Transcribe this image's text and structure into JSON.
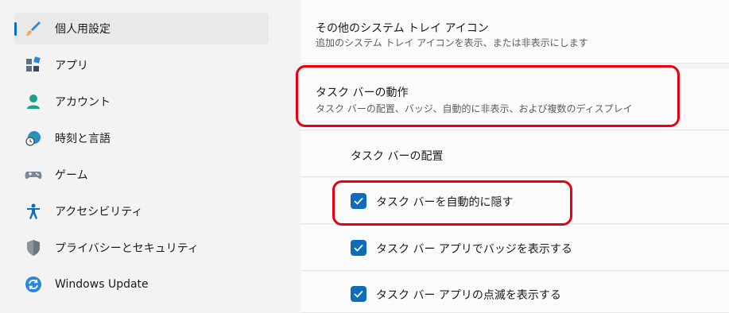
{
  "sidebar": {
    "items": [
      {
        "label": "個人用設定",
        "icon": "paintbrush-icon",
        "active": true
      },
      {
        "label": "アプリ",
        "icon": "apps-icon"
      },
      {
        "label": "アカウント",
        "icon": "person-icon"
      },
      {
        "label": "時刻と言語",
        "icon": "globe-clock-icon"
      },
      {
        "label": "ゲーム",
        "icon": "gamepad-icon"
      },
      {
        "label": "アクセシビリティ",
        "icon": "accessibility-icon"
      },
      {
        "label": "プライバシーとセキュリティ",
        "icon": "shield-icon"
      },
      {
        "label": "Windows Update",
        "icon": "update-icon"
      }
    ]
  },
  "content": {
    "tray_card": {
      "title": "その他のシステム トレイ アイコン",
      "subtitle": "追加のシステム トレイ アイコンを表示、または非表示にします"
    },
    "behavior_card": {
      "title": "タスク バーの動作",
      "subtitle": "タスク バーの配置、バッジ、自動的に非表示、および複数のディスプレイ"
    },
    "alignment_label": "タスク バーの配置",
    "options": [
      {
        "label": "タスク バーを自動的に隠す",
        "checked": true
      },
      {
        "label": "タスク バー アプリでバッジを表示する",
        "checked": true
      },
      {
        "label": "タスク バー アプリの点滅を表示する",
        "checked": true
      }
    ]
  },
  "colors": {
    "accent": "#0f6cbd",
    "highlight": "#e60012"
  }
}
